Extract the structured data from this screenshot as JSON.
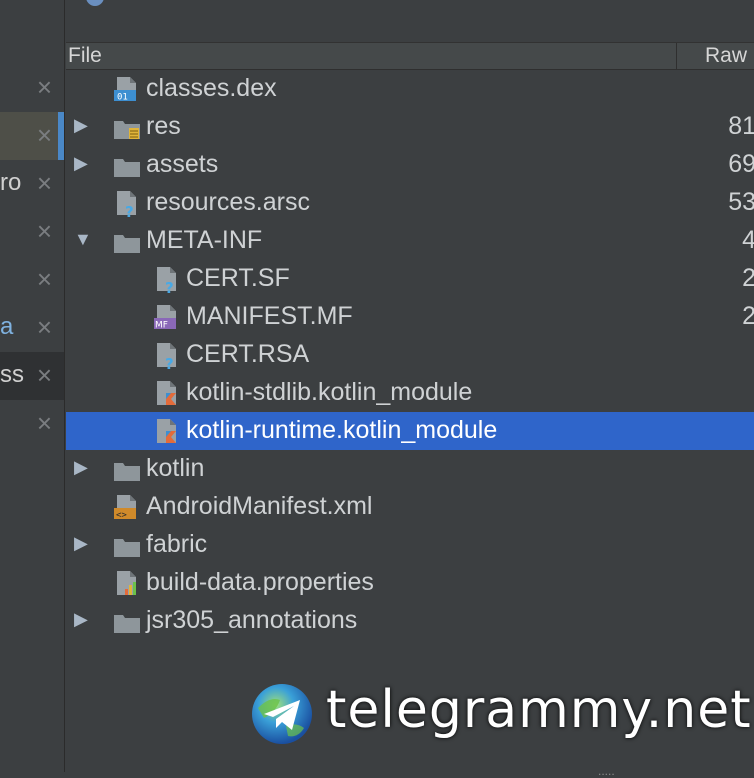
{
  "left_tabs": [
    {
      "fragment": "",
      "close": "×",
      "state": "normal"
    },
    {
      "fragment": "",
      "close": "×",
      "state": "selected"
    },
    {
      "fragment": "ro",
      "close": "×",
      "state": "normal"
    },
    {
      "fragment": "",
      "close": "×",
      "state": "normal"
    },
    {
      "fragment": "",
      "close": "×",
      "state": "normal"
    },
    {
      "fragment": "a",
      "close": "×",
      "state": "normal"
    },
    {
      "fragment": "ss",
      "close": "×",
      "state": "dark"
    },
    {
      "fragment": "",
      "close": "×",
      "state": "normal"
    }
  ],
  "header": {
    "file_label": "File",
    "raw_label": "Raw"
  },
  "tree": [
    {
      "label": "classes.dex",
      "size": "",
      "icon": "dex-file-icon",
      "arrow": "",
      "indent": 0
    },
    {
      "label": "res",
      "size": "81",
      "icon": "res-folder-icon",
      "arrow": "▶",
      "indent": 0
    },
    {
      "label": "assets",
      "size": "69",
      "icon": "folder-icon",
      "arrow": "▶",
      "indent": 0
    },
    {
      "label": "resources.arsc",
      "size": "53",
      "icon": "unknown-file-icon",
      "arrow": "",
      "indent": 0
    },
    {
      "label": "META-INF",
      "size": "4",
      "icon": "folder-icon",
      "arrow": "▼",
      "indent": 0
    },
    {
      "label": "CERT.SF",
      "size": "2",
      "icon": "unknown-file-icon",
      "arrow": "",
      "indent": 1
    },
    {
      "label": "MANIFEST.MF",
      "size": "2",
      "icon": "manifest-file-icon",
      "arrow": "",
      "indent": 1
    },
    {
      "label": "CERT.RSA",
      "size": "",
      "icon": "unknown-file-icon",
      "arrow": "",
      "indent": 1
    },
    {
      "label": "kotlin-stdlib.kotlin_module",
      "size": "",
      "icon": "kotlin-file-icon",
      "arrow": "",
      "indent": 1
    },
    {
      "label": "kotlin-runtime.kotlin_module",
      "size": "",
      "icon": "kotlin-file-icon",
      "arrow": "",
      "indent": 1,
      "selected": true
    },
    {
      "label": "kotlin",
      "size": "",
      "icon": "folder-icon",
      "arrow": "▶",
      "indent": 0
    },
    {
      "label": "AndroidManifest.xml",
      "size": "",
      "icon": "xml-file-icon",
      "arrow": "",
      "indent": 0
    },
    {
      "label": "fabric",
      "size": "",
      "icon": "folder-icon",
      "arrow": "▶",
      "indent": 0
    },
    {
      "label": "build-data.properties",
      "size": "",
      "icon": "properties-file-icon",
      "arrow": "",
      "indent": 0
    },
    {
      "label": "jsr305_annotations",
      "size": "",
      "icon": "folder-icon",
      "arrow": "▶",
      "indent": 0
    }
  ],
  "watermark": {
    "text": "telegrammy.net",
    "icon": "telegram-globe-icon"
  },
  "colors": {
    "selection": "#2f65ca",
    "background": "#3c3f41",
    "accent": "#4a88c7"
  }
}
